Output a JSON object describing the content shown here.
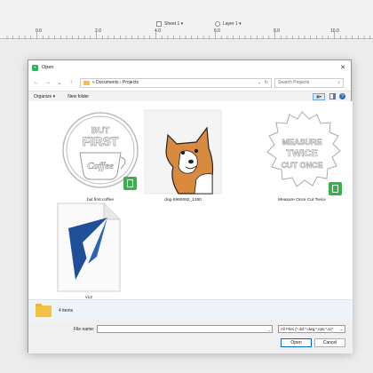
{
  "app": {
    "sheet_label": "Sheet 1 ▾",
    "layer_label": "Layer 1 ▾",
    "ruler_labels": [
      "0.0",
      "2.0",
      "4.0",
      "6.0",
      "8.0",
      "10.0"
    ]
  },
  "dialog": {
    "title": "Open",
    "close": "✕",
    "nav": {
      "back": "←",
      "forward": "→",
      "recent": "⌄",
      "up": "↑"
    },
    "breadcrumb": "« Documents › Projects",
    "address_dropdown": "⌄",
    "refresh": "↻",
    "search_placeholder": "Search Projects",
    "search_icon": "⌕",
    "organize_label": "Organize ▾",
    "new_folder_label": "New folder",
    "help": "?",
    "files": [
      {
        "label": "but first coffee",
        "kind": "svg-design",
        "badge": true,
        "art_lines": [
          "BUT",
          "FIRST",
          "Coffee"
        ]
      },
      {
        "label": "dog-5960092_1280",
        "kind": "photo",
        "badge": false
      },
      {
        "label": "Measure Once Cut Twice",
        "kind": "svg-design",
        "badge": true,
        "art_lines": [
          "MEASURE",
          "TWICE",
          "CUT ONCE"
        ]
      },
      {
        "label": "v12",
        "kind": "document",
        "badge": false
      }
    ],
    "details_count": "4 items",
    "filename_label": "File name:",
    "filename_value": "",
    "filetype_value": "All Files (*.dxf;*.dwg;*.eps;*.ai;*",
    "open_label": "Open",
    "cancel_label": "Cancel"
  },
  "colors": {
    "badge_green": "#36b34a",
    "logo_blue": "#1f4f98",
    "accent_blue": "#0a64c8"
  }
}
